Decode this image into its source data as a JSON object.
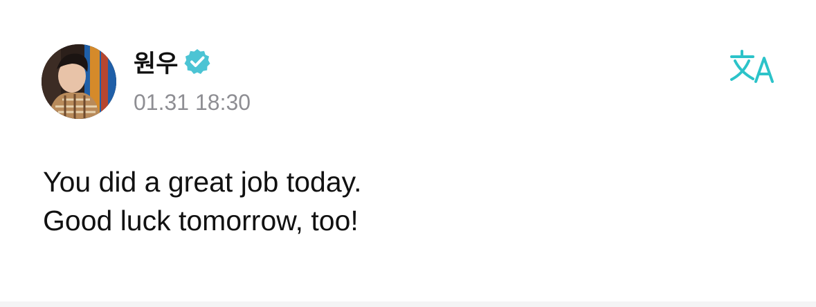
{
  "author": {
    "name": "원우",
    "avatar_icon": "avatar",
    "verified_icon": "verified-badge-icon",
    "verified_color": "#4cc4d4"
  },
  "post": {
    "timestamp": "01.31 18:30",
    "lines": [
      "You did a great job today.",
      "Good luck tomorrow, too!"
    ]
  },
  "actions": {
    "translate_icon": "translate-icon",
    "accent_color": "#2cc3c9"
  }
}
